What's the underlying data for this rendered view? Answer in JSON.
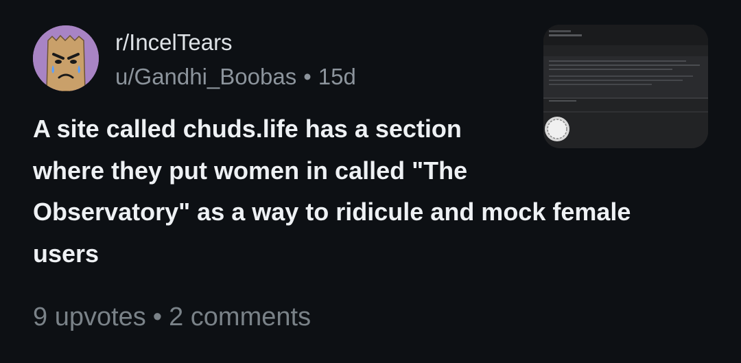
{
  "post": {
    "subreddit": "r/IncelTears",
    "author": "u/Gandhi_Boobas",
    "separator": "•",
    "age": "15d",
    "title_lines": [
      "A site called chuds.life has a section",
      "where they put women in called \"The",
      "Observatory\" as a way to ridicule and mock female",
      "users"
    ],
    "upvotes": "9 upvotes",
    "comments": "2 comments"
  },
  "colors": {
    "background": "#0d1014",
    "avatar": "#a884c4",
    "title": "#eef1f4",
    "meta": "#8c949c"
  },
  "icons": {
    "avatar": "paper-bag-crying-face-icon"
  }
}
